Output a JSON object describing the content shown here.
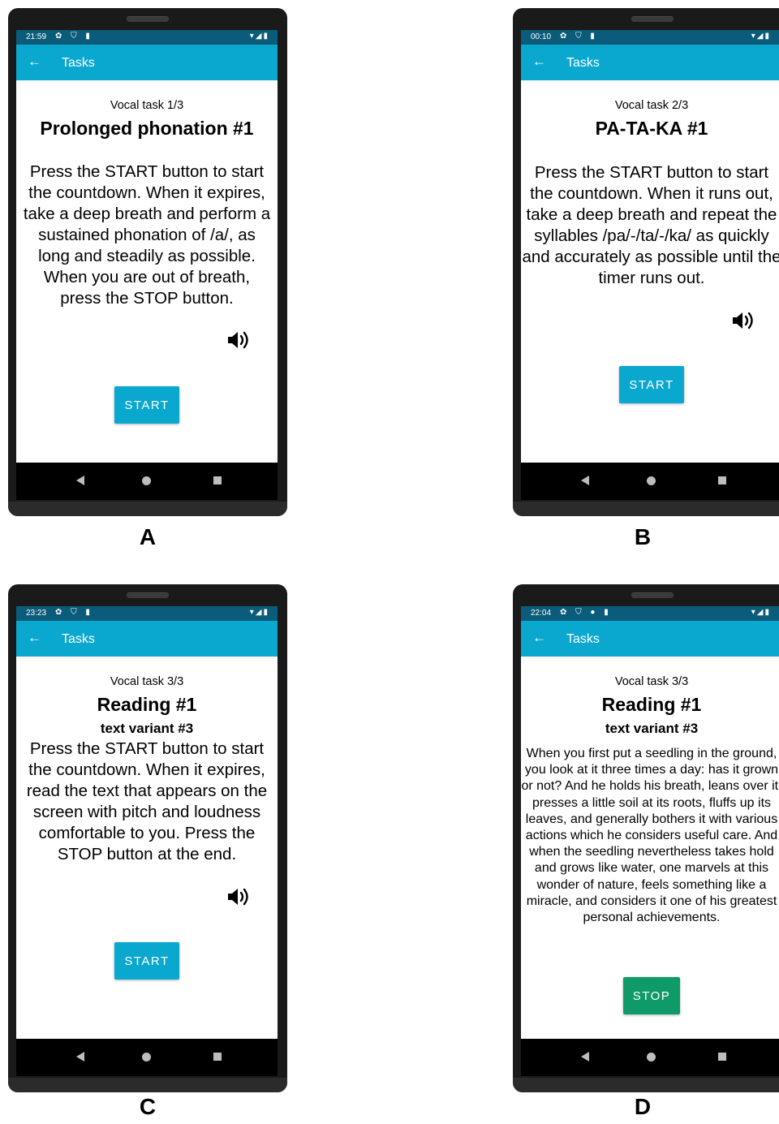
{
  "colors": {
    "statusbar": "#0b5c7a",
    "appbar": "#0aa7cf",
    "start_button": "#0aa7cf",
    "stop_button": "#0f9a6a",
    "device": "#1a1a1a"
  },
  "panels": [
    {
      "label": "A",
      "status": {
        "time": "21:59",
        "left_icons": "✿ ⛉ ▮",
        "right_icons": "▾◢▮"
      },
      "appbar_title": "Tasks",
      "counter": "Vocal task 1/3",
      "heading": "Prolonged phonation #1",
      "variant": "",
      "instructions": "Press the START button to start the countdown. When it expires, take a deep breath and perform a sustained phonation of /a/, as long and steadily as possible. When you are out of breath, press the STOP button.",
      "button": "START",
      "icon": "speaker-icon"
    },
    {
      "label": "B",
      "status": {
        "time": "00:10",
        "left_icons": "✿ ⛉ ▮",
        "right_icons": "▾◢▮"
      },
      "appbar_title": "Tasks",
      "counter": "Vocal task 2/3",
      "heading": "PA-TA-KA #1",
      "variant": "",
      "instructions": "Press the START button to start the countdown. When it runs out, take a deep breath and repeat the syllables /pa/-/ta/-/ka/ as quickly and accurately as possible until the timer runs out.",
      "button": "START",
      "icon": "speaker-icon"
    },
    {
      "label": "C",
      "status": {
        "time": "23:23",
        "left_icons": "✿ ⛉ ▮",
        "right_icons": "▾◢▮"
      },
      "appbar_title": "Tasks",
      "counter": "Vocal task 3/3",
      "heading": "Reading #1",
      "variant": "text variant #3",
      "instructions": "Press the START button to start the countdown. When it expires, read the text that appears on the screen with pitch and loudness comfortable to you. Press the STOP button at the end.",
      "button": "START",
      "icon": "speaker-icon"
    },
    {
      "label": "D",
      "status": {
        "time": "22:04",
        "left_icons": "✿ ⛉ ● ▮",
        "right_icons": "▾◢▮"
      },
      "appbar_title": "Tasks",
      "counter": "Vocal task 3/3",
      "heading": "Reading #1",
      "variant": "text variant #3",
      "reading_text": "When you first put a seedling in the ground, you look at it three times a day: has it grown or not? And he holds his breath, leans over it, presses a little soil at its roots, fluffs up its leaves, and generally bothers it with various actions which he considers useful care. And when the seedling nevertheless takes hold and grows like water, one marvels at this wonder of nature, feels something like a miracle, and considers it one of his greatest personal achievements.",
      "button": "STOP"
    }
  ]
}
